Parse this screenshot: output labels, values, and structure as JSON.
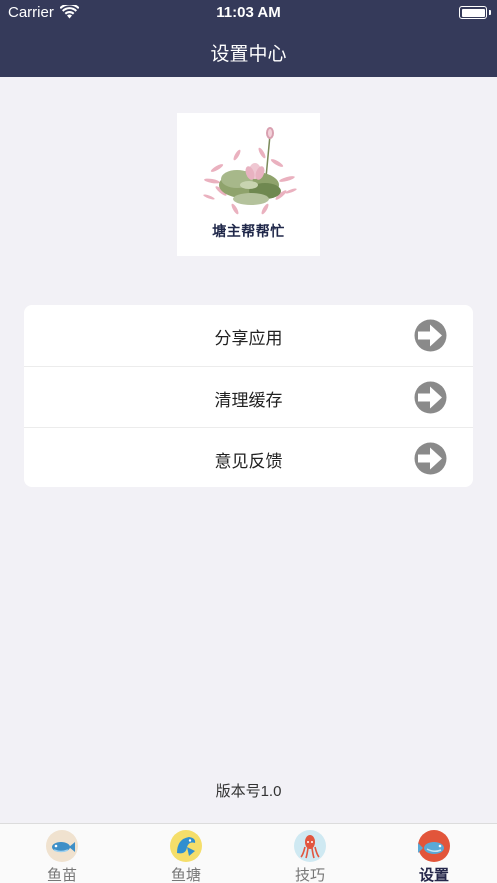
{
  "status_bar": {
    "carrier": "Carrier",
    "time": "11:03 AM"
  },
  "nav": {
    "title": "设置中心"
  },
  "logo": {
    "text": "塘主帮帮忙"
  },
  "menu": {
    "items": [
      {
        "label": "分享应用",
        "icon": "arrow-right-circle-icon"
      },
      {
        "label": "清理缓存",
        "icon": "arrow-right-circle-icon"
      },
      {
        "label": "意见反馈",
        "icon": "arrow-right-circle-icon"
      }
    ]
  },
  "version": "版本号1.0",
  "tabs": [
    {
      "label": "鱼苗",
      "icon": "fish-fry-icon",
      "active": false
    },
    {
      "label": "鱼塘",
      "icon": "fish-pond-icon",
      "active": false
    },
    {
      "label": "技巧",
      "icon": "squid-tips-icon",
      "active": false
    },
    {
      "label": "设置",
      "icon": "settings-fish-icon",
      "active": true
    }
  ],
  "colors": {
    "nav_bg": "#353a5a",
    "page_bg": "#f2f1f6",
    "arrow": "#8a8a8a",
    "active_tab": "#25274a"
  }
}
